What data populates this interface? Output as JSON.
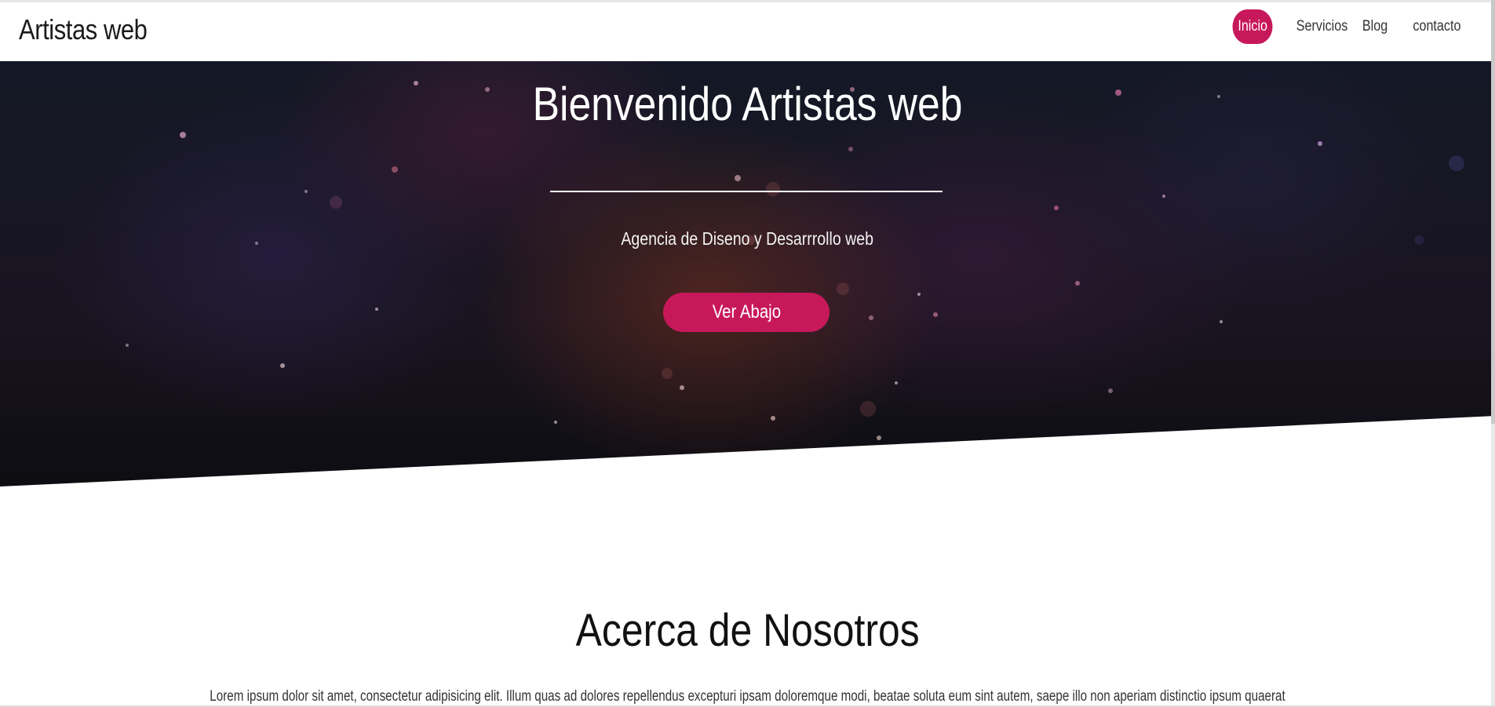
{
  "navbar": {
    "brand": "Artistas web",
    "items": [
      {
        "label": "Inicio",
        "active": true
      },
      {
        "label": "Servicios",
        "active": false
      },
      {
        "label": "Blog",
        "active": false
      },
      {
        "label": "contacto",
        "active": false
      }
    ]
  },
  "hero": {
    "title": "Bienvenido Artistas web",
    "subtitle": "Agencia de Diseno y Desarrrollo web",
    "button_label": "Ver Abajo"
  },
  "about": {
    "title": "Acerca de Nosotros",
    "text": "Lorem ipsum dolor sit amet, consectetur adipisicing elit. Illum quas ad dolores repellendus excepturi ipsam doloremque modi, beatae soluta eum sint autem, saepe illo non aperiam distinctio ipsum quaerat"
  },
  "colors": {
    "accent": "#c8185c",
    "hero_background": "#141826",
    "text_dark": "#1b1b1b",
    "text_light": "#ffffff"
  }
}
